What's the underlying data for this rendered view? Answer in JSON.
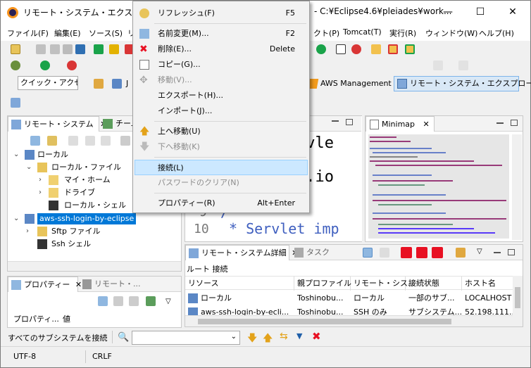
{
  "window": {
    "title_left": "リモート・システム・エクスプローラー",
    "title_right": "- C:¥Eclipse4.6¥pleiades¥work...",
    "minimize": "—",
    "maximize": "☐",
    "close": "✕"
  },
  "menubar": {
    "items": [
      "ファイル(F)",
      "編集(E)",
      "ソース(S)",
      "リ",
      "クト(P)",
      "Tomcat(T)",
      "実行(R)",
      "ウィンドウ(W)",
      "ヘルプ(H)"
    ]
  },
  "toolbar": {
    "quick_access_placeholder": "クイック・アクセス",
    "perspective_aws": "AWS Management",
    "perspective_rse": "リモート・システム・エクスプローラー",
    "java_short": "J"
  },
  "context_menu": {
    "items": [
      {
        "label": "リフレッシュ(F)",
        "shortcut": "F5"
      },
      {
        "label": "名前変更(M)...",
        "shortcut": "F2"
      },
      {
        "label": "削除(E)...",
        "shortcut": "Delete"
      },
      {
        "label": "コピー(G)...",
        "shortcut": ""
      },
      {
        "label": "移動(V)...",
        "shortcut": ""
      },
      {
        "label": "エクスポート(H)...",
        "shortcut": ""
      },
      {
        "label": "インポート(J)...",
        "shortcut": ""
      },
      {
        "label": "上へ移動(U)",
        "shortcut": ""
      },
      {
        "label": "下へ移動(K)",
        "shortcut": ""
      },
      {
        "label": "接続(L)",
        "shortcut": ""
      },
      {
        "label": "パスワードのクリア(N)",
        "shortcut": ""
      },
      {
        "label": "プロパティー(R)",
        "shortcut": "Alt+Enter"
      }
    ]
  },
  "remote_view": {
    "tab_label": "リモート・システム",
    "tab2_label": "チーム",
    "tree": [
      {
        "label": "ローカル"
      },
      {
        "label": "ローカル・ファイル"
      },
      {
        "label": "マイ・ホーム"
      },
      {
        "label": "ドライブ"
      },
      {
        "label": "ローカル・シェル"
      },
      {
        "label": "aws-ssh-login-by-eclipse"
      },
      {
        "label": "Sftp ファイル"
      },
      {
        "label": "Ssh シェル"
      }
    ]
  },
  "editor": {
    "line_a": "rvle",
    "line_b": "a.io",
    "line_c_num": "9",
    "line_c": "/**",
    "line_d_num": "10",
    "line_d": "* Servlet imp"
  },
  "minimap": {
    "tab_label": "Minimap"
  },
  "properties_view": {
    "tab_label": "プロパティー",
    "tab2_label": "リモート・...",
    "col_property": "プロパティ...",
    "col_value": "値"
  },
  "details_view": {
    "tab_label": "リモート・システム詳細",
    "tab2_label": "タスク",
    "breadcrumb": "ルート 接続",
    "columns": [
      "リソース",
      "親プロファイル",
      "リモート・シス...",
      "接続状態",
      "ホスト名"
    ],
    "rows": [
      [
        "ローカル",
        "Toshinobu...",
        "ローカル",
        "一部のサブ...",
        "LOCALHOST"
      ],
      [
        "aws-ssh-login-by-ecli...",
        "Toshinobu...",
        "SSH のみ",
        "サブシステム...",
        "52.198.111..."
      ]
    ]
  },
  "bottom_toolbar": {
    "connect_all": "すべてのサブシステムを接続"
  },
  "statusbar": {
    "encoding": "UTF-8",
    "line_ending": "CRLF"
  },
  "colors": {
    "accent": "#0078d7",
    "selection": "#0078d7",
    "menu_highlight": "#cce8ff",
    "stop_red": "#e81123"
  }
}
